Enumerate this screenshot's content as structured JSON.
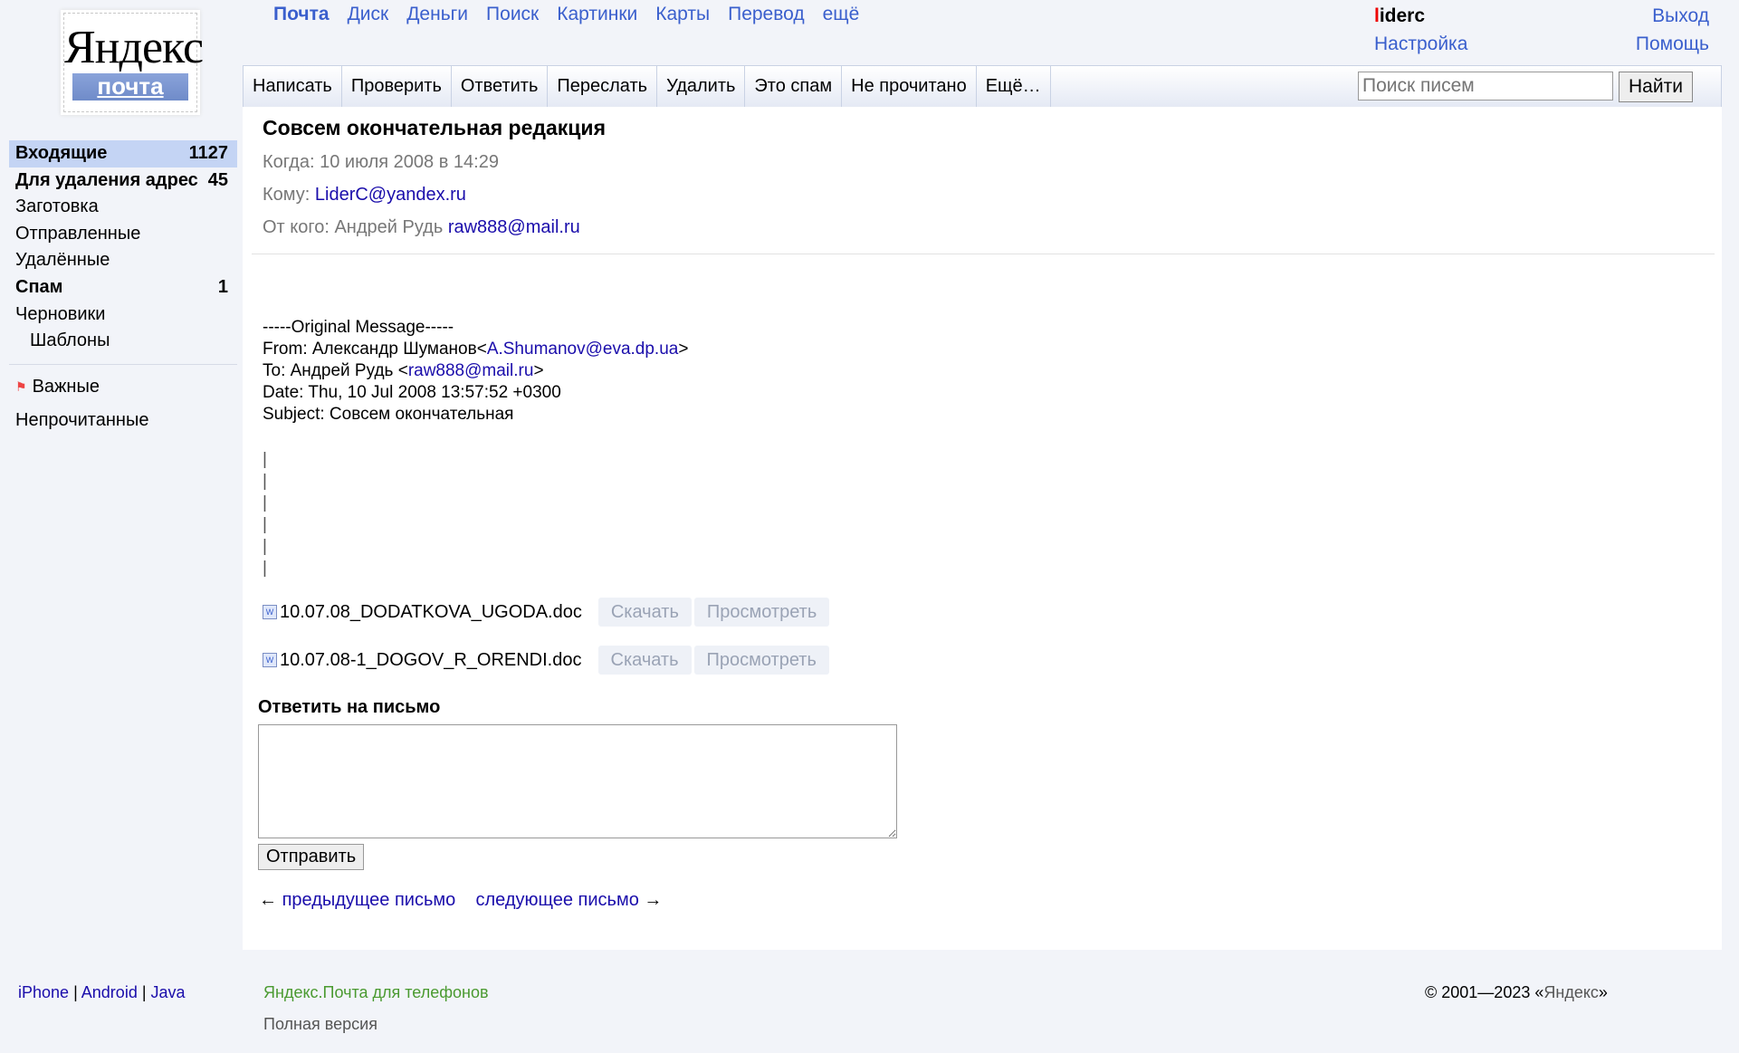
{
  "logo": {
    "brand": "Яндекс",
    "service": "почта"
  },
  "topnav": [
    {
      "label": "Почта"
    },
    {
      "label": "Диск"
    },
    {
      "label": "Деньги"
    },
    {
      "label": "Поиск"
    },
    {
      "label": "Картинки"
    },
    {
      "label": "Карты"
    },
    {
      "label": "Перевод"
    },
    {
      "label": "ещё"
    }
  ],
  "user": {
    "first_letter": "l",
    "rest": "iderc",
    "settings": "Настройка",
    "logout": "Выход",
    "help": "Помощь"
  },
  "toolbar": [
    "Написать",
    "Проверить",
    "Ответить",
    "Переслать",
    "Удалить",
    "Это спам",
    "Не прочитано",
    "Ещё…"
  ],
  "search": {
    "placeholder": "Поиск писем",
    "button": "Найти"
  },
  "folders": [
    {
      "label": "Входящие",
      "count": "1127"
    },
    {
      "label": "Для удаления адрес",
      "count": "45"
    },
    {
      "label": "Заготовка",
      "count": ""
    },
    {
      "label": "Отправленные",
      "count": ""
    },
    {
      "label": "Удалённые",
      "count": ""
    },
    {
      "label": "Спам",
      "count": "1"
    },
    {
      "label": "Черновики",
      "count": ""
    },
    {
      "label": "Шаблоны",
      "count": ""
    }
  ],
  "labels": {
    "important": "Важные",
    "unread": "Непрочитанные"
  },
  "message": {
    "subject": "Совсем окончательная редакция",
    "when_label": "Когда:",
    "when": "10 июля 2008 в 14:29",
    "to_label": "Кому:",
    "to": "LiderC@yandex.ru",
    "from_label": "От кого:",
    "from_name": "Андрей Рудь",
    "from_email": "raw888@mail.ru",
    "orig_header": "-----Original Message-----",
    "orig_from_prefix": "From: Александр Шуманов<",
    "orig_from_email": "A.Shumanov@eva.dp.ua",
    "orig_from_suffix": ">",
    "orig_to_prefix": "To: Андрей Рудь <",
    "orig_to_email": "raw888@mail.ru",
    "orig_to_suffix": ">",
    "orig_date": "Date: Thu, 10 Jul 2008 13:57:52 +0300",
    "orig_subject": "Subject: Совсем окончательная",
    "quote_lines": [
      "|",
      "|",
      "|",
      "|",
      "|",
      "|"
    ]
  },
  "attachments": [
    {
      "name": "10.07.08_DODATKOVA_UGODA.doc",
      "download": "Скачать",
      "view": "Просмотреть"
    },
    {
      "name": "10.07.08-1_DOGOV_R_ORENDI.doc",
      "download": "Скачать",
      "view": "Просмотреть"
    }
  ],
  "reply": {
    "label": "Ответить на письмо",
    "send": "Отправить"
  },
  "pager": {
    "prev_arrow": "←",
    "prev": "предыдущее письмо",
    "next": "следующее письмо",
    "next_arrow": "→"
  },
  "footer": {
    "iphone": "iPhone",
    "android": "Android",
    "java": "Java",
    "pipe": "|",
    "mobile": "Яндекс.Почта для телефонов",
    "full": "Полная версия",
    "copyright_prefix": "© 2001—2023 «",
    "copyright_link": "Яндекс",
    "copyright_suffix": "»"
  }
}
